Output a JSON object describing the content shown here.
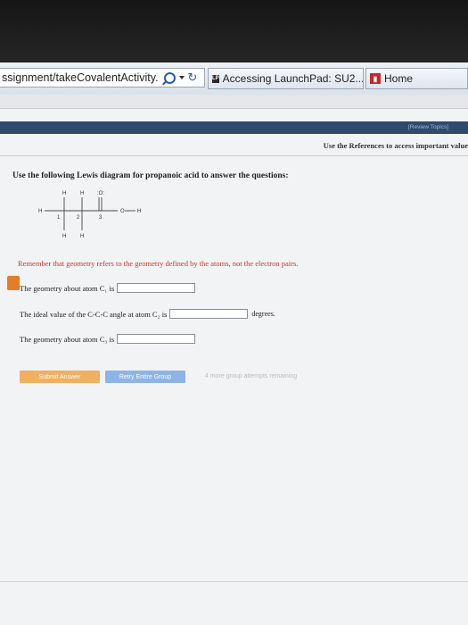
{
  "browser": {
    "address_text": "ssignment/takeCovalentActivity.",
    "tabs": [
      {
        "label": "Accessing LaunchPad: SU2...",
        "favicon": "LP"
      },
      {
        "label": "Home"
      }
    ]
  },
  "header": {
    "review_topics": "[Review Topics]",
    "references_text": "Use the References to access important value"
  },
  "question": {
    "prompt": "Use the following Lewis diagram for propanoic acid to answer the questions:",
    "reminder": "Remember that geometry refers to the geometry defined by the atoms, not the electron pairs.",
    "items": [
      {
        "label": "The geometry about atom C₁ is",
        "value": ""
      },
      {
        "label": "The ideal value of the C-C-C angle at atom C₂ is",
        "value": "",
        "unit": "degrees."
      },
      {
        "label": "The geometry about atom C₃ is",
        "value": ""
      }
    ]
  },
  "diagram": {
    "atom_labels": [
      "H",
      "H",
      ":O:",
      "H",
      "1",
      "2",
      "3",
      "O",
      "H",
      "H",
      "H"
    ]
  },
  "actions": {
    "submit": "Submit Answer",
    "retry": "Retry Entire Group",
    "attempts": "4 more group attempts remaining"
  }
}
